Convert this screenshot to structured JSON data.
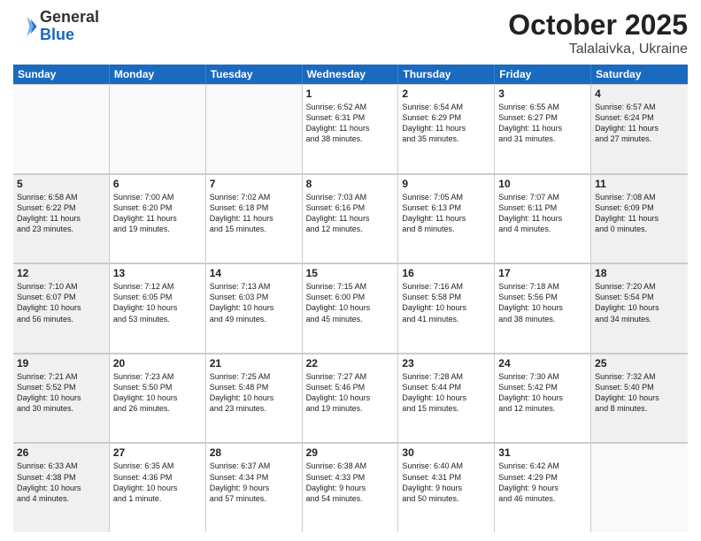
{
  "header": {
    "logo_line1": "General",
    "logo_line2": "Blue",
    "title": "October 2025",
    "subtitle": "Talalaivka, Ukraine"
  },
  "days_of_week": [
    "Sunday",
    "Monday",
    "Tuesday",
    "Wednesday",
    "Thursday",
    "Friday",
    "Saturday"
  ],
  "weeks": [
    [
      {
        "day": "",
        "text": "",
        "empty": true
      },
      {
        "day": "",
        "text": "",
        "empty": true
      },
      {
        "day": "",
        "text": "",
        "empty": true
      },
      {
        "day": "1",
        "text": "Sunrise: 6:52 AM\nSunset: 6:31 PM\nDaylight: 11 hours\nand 38 minutes.",
        "empty": false
      },
      {
        "day": "2",
        "text": "Sunrise: 6:54 AM\nSunset: 6:29 PM\nDaylight: 11 hours\nand 35 minutes.",
        "empty": false
      },
      {
        "day": "3",
        "text": "Sunrise: 6:55 AM\nSunset: 6:27 PM\nDaylight: 11 hours\nand 31 minutes.",
        "empty": false
      },
      {
        "day": "4",
        "text": "Sunrise: 6:57 AM\nSunset: 6:24 PM\nDaylight: 11 hours\nand 27 minutes.",
        "empty": false,
        "shaded": true
      }
    ],
    [
      {
        "day": "5",
        "text": "Sunrise: 6:58 AM\nSunset: 6:22 PM\nDaylight: 11 hours\nand 23 minutes.",
        "empty": false,
        "shaded": true
      },
      {
        "day": "6",
        "text": "Sunrise: 7:00 AM\nSunset: 6:20 PM\nDaylight: 11 hours\nand 19 minutes.",
        "empty": false
      },
      {
        "day": "7",
        "text": "Sunrise: 7:02 AM\nSunset: 6:18 PM\nDaylight: 11 hours\nand 15 minutes.",
        "empty": false
      },
      {
        "day": "8",
        "text": "Sunrise: 7:03 AM\nSunset: 6:16 PM\nDaylight: 11 hours\nand 12 minutes.",
        "empty": false
      },
      {
        "day": "9",
        "text": "Sunrise: 7:05 AM\nSunset: 6:13 PM\nDaylight: 11 hours\nand 8 minutes.",
        "empty": false
      },
      {
        "day": "10",
        "text": "Sunrise: 7:07 AM\nSunset: 6:11 PM\nDaylight: 11 hours\nand 4 minutes.",
        "empty": false
      },
      {
        "day": "11",
        "text": "Sunrise: 7:08 AM\nSunset: 6:09 PM\nDaylight: 11 hours\nand 0 minutes.",
        "empty": false,
        "shaded": true
      }
    ],
    [
      {
        "day": "12",
        "text": "Sunrise: 7:10 AM\nSunset: 6:07 PM\nDaylight: 10 hours\nand 56 minutes.",
        "empty": false,
        "shaded": true
      },
      {
        "day": "13",
        "text": "Sunrise: 7:12 AM\nSunset: 6:05 PM\nDaylight: 10 hours\nand 53 minutes.",
        "empty": false
      },
      {
        "day": "14",
        "text": "Sunrise: 7:13 AM\nSunset: 6:03 PM\nDaylight: 10 hours\nand 49 minutes.",
        "empty": false
      },
      {
        "day": "15",
        "text": "Sunrise: 7:15 AM\nSunset: 6:00 PM\nDaylight: 10 hours\nand 45 minutes.",
        "empty": false
      },
      {
        "day": "16",
        "text": "Sunrise: 7:16 AM\nSunset: 5:58 PM\nDaylight: 10 hours\nand 41 minutes.",
        "empty": false
      },
      {
        "day": "17",
        "text": "Sunrise: 7:18 AM\nSunset: 5:56 PM\nDaylight: 10 hours\nand 38 minutes.",
        "empty": false
      },
      {
        "day": "18",
        "text": "Sunrise: 7:20 AM\nSunset: 5:54 PM\nDaylight: 10 hours\nand 34 minutes.",
        "empty": false,
        "shaded": true
      }
    ],
    [
      {
        "day": "19",
        "text": "Sunrise: 7:21 AM\nSunset: 5:52 PM\nDaylight: 10 hours\nand 30 minutes.",
        "empty": false,
        "shaded": true
      },
      {
        "day": "20",
        "text": "Sunrise: 7:23 AM\nSunset: 5:50 PM\nDaylight: 10 hours\nand 26 minutes.",
        "empty": false
      },
      {
        "day": "21",
        "text": "Sunrise: 7:25 AM\nSunset: 5:48 PM\nDaylight: 10 hours\nand 23 minutes.",
        "empty": false
      },
      {
        "day": "22",
        "text": "Sunrise: 7:27 AM\nSunset: 5:46 PM\nDaylight: 10 hours\nand 19 minutes.",
        "empty": false
      },
      {
        "day": "23",
        "text": "Sunrise: 7:28 AM\nSunset: 5:44 PM\nDaylight: 10 hours\nand 15 minutes.",
        "empty": false
      },
      {
        "day": "24",
        "text": "Sunrise: 7:30 AM\nSunset: 5:42 PM\nDaylight: 10 hours\nand 12 minutes.",
        "empty": false
      },
      {
        "day": "25",
        "text": "Sunrise: 7:32 AM\nSunset: 5:40 PM\nDaylight: 10 hours\nand 8 minutes.",
        "empty": false,
        "shaded": true
      }
    ],
    [
      {
        "day": "26",
        "text": "Sunrise: 6:33 AM\nSunset: 4:38 PM\nDaylight: 10 hours\nand 4 minutes.",
        "empty": false,
        "shaded": true
      },
      {
        "day": "27",
        "text": "Sunrise: 6:35 AM\nSunset: 4:36 PM\nDaylight: 10 hours\nand 1 minute.",
        "empty": false
      },
      {
        "day": "28",
        "text": "Sunrise: 6:37 AM\nSunset: 4:34 PM\nDaylight: 9 hours\nand 57 minutes.",
        "empty": false
      },
      {
        "day": "29",
        "text": "Sunrise: 6:38 AM\nSunset: 4:33 PM\nDaylight: 9 hours\nand 54 minutes.",
        "empty": false
      },
      {
        "day": "30",
        "text": "Sunrise: 6:40 AM\nSunset: 4:31 PM\nDaylight: 9 hours\nand 50 minutes.",
        "empty": false
      },
      {
        "day": "31",
        "text": "Sunrise: 6:42 AM\nSunset: 4:29 PM\nDaylight: 9 hours\nand 46 minutes.",
        "empty": false
      },
      {
        "day": "",
        "text": "",
        "empty": true
      }
    ]
  ]
}
